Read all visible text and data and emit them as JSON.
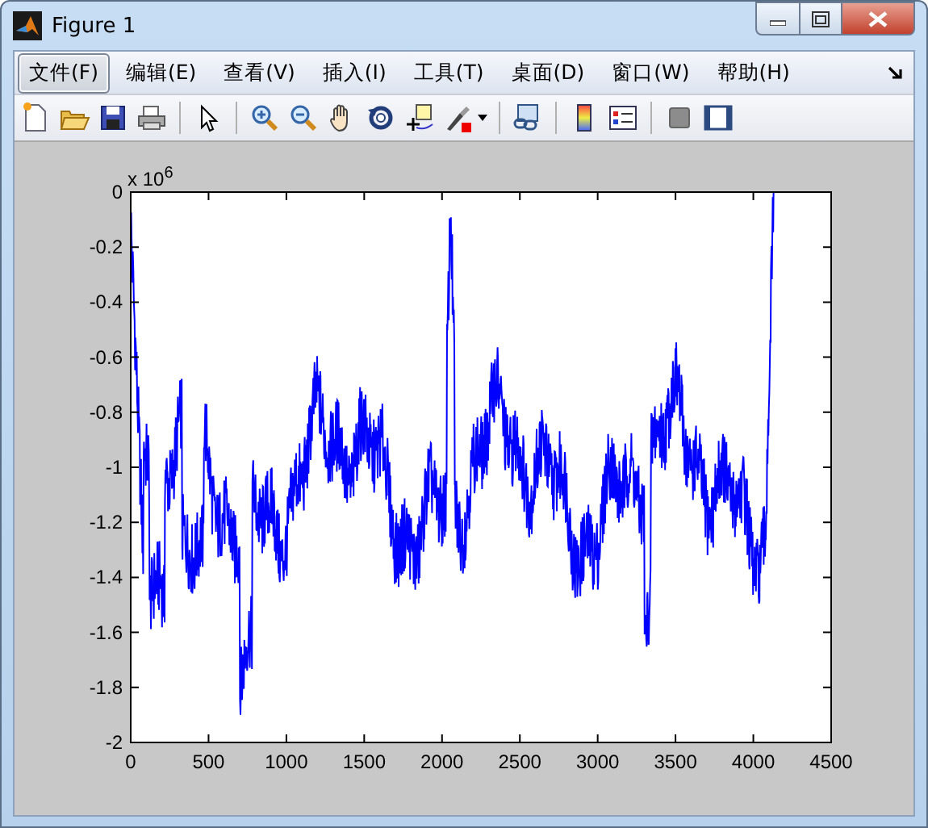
{
  "window": {
    "title": "Figure 1"
  },
  "menu": [
    {
      "label": "文件(F)",
      "selected": true
    },
    {
      "label": "编辑(E)",
      "selected": false
    },
    {
      "label": "查看(V)",
      "selected": false
    },
    {
      "label": "插入(I)",
      "selected": false
    },
    {
      "label": "工具(T)",
      "selected": false
    },
    {
      "label": "桌面(D)",
      "selected": false
    },
    {
      "label": "窗口(W)",
      "selected": false
    },
    {
      "label": "帮助(H)",
      "selected": false
    }
  ],
  "axes": {
    "exponent": "x 10$^{6}$",
    "yticks": [
      "0",
      "-0.2",
      "-0.4",
      "-0.6",
      "-0.8",
      "-1",
      "-1.2",
      "-1.4",
      "-1.6",
      "-1.8",
      "-2"
    ],
    "xticks": [
      "0",
      "500",
      "1000",
      "1500",
      "2000",
      "2500",
      "3000",
      "3500",
      "4000",
      "4500"
    ]
  }
}
